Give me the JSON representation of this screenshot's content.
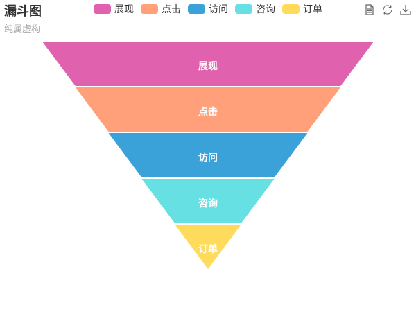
{
  "chart_data": {
    "type": "funnel",
    "title": "漏斗图",
    "subtitle": "纯属虚构",
    "categories": [
      "展现",
      "点击",
      "访问",
      "咨询",
      "订单"
    ],
    "values": [
      100,
      80,
      60,
      40,
      20
    ],
    "colors": [
      "#e062ae",
      "#ffa07a",
      "#3aa1d9",
      "#66e0e3",
      "#ffdb5c"
    ],
    "sort": "descending",
    "legend_position": "top-center"
  },
  "toolbox": {
    "data_view_icon": "document-icon",
    "restore_icon": "refresh-icon",
    "save_icon": "download-icon"
  }
}
